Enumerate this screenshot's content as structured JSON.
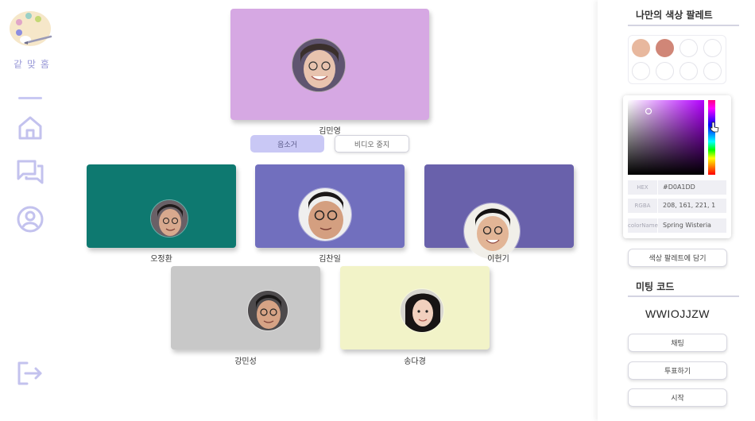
{
  "logo": {
    "text": "같 맞 홈"
  },
  "nav": {
    "items": [
      {
        "icon": "home-icon"
      },
      {
        "icon": "chat-icon"
      },
      {
        "icon": "user-icon"
      }
    ],
    "logout_icon": "logout-icon"
  },
  "host": {
    "name": "김민영",
    "tile_color": "#D6A8E3"
  },
  "controls": {
    "mute_label": "음소거",
    "video_stop_label": "비디오 중지"
  },
  "participants": [
    {
      "name": "오정환",
      "tile_color": "#0E7970"
    },
    {
      "name": "김찬일",
      "tile_color": "#716FBE"
    },
    {
      "name": "이헌기",
      "tile_color": "#6961AB"
    },
    {
      "name": "강민성",
      "tile_color": "#C8C8C8"
    },
    {
      "name": "송다경",
      "tile_color": "#F2F3C8"
    }
  ],
  "palette": {
    "title": "나만의 색상 팔레트",
    "swatches": [
      "#E8B89E",
      "#D08677",
      "",
      "",
      "",
      "",
      "",
      ""
    ]
  },
  "picker": {
    "rows": [
      {
        "label": "HEX",
        "value": "#D0A1DD"
      },
      {
        "label": "RGBA",
        "value": "208, 161, 221, 1"
      },
      {
        "label": "colorName",
        "value": "Spring Wisteria"
      }
    ]
  },
  "actions": {
    "save_palette_label": "색상 팔레트에 담기",
    "meeting_code_title": "미팅 코드",
    "meeting_code": "WWIOJJZW",
    "chat_label": "채팅",
    "vote_label": "투표하기",
    "start_label": "시작"
  },
  "colors": {
    "accent": "#C9C8F5",
    "nav_icon": "#C3C2EE"
  }
}
